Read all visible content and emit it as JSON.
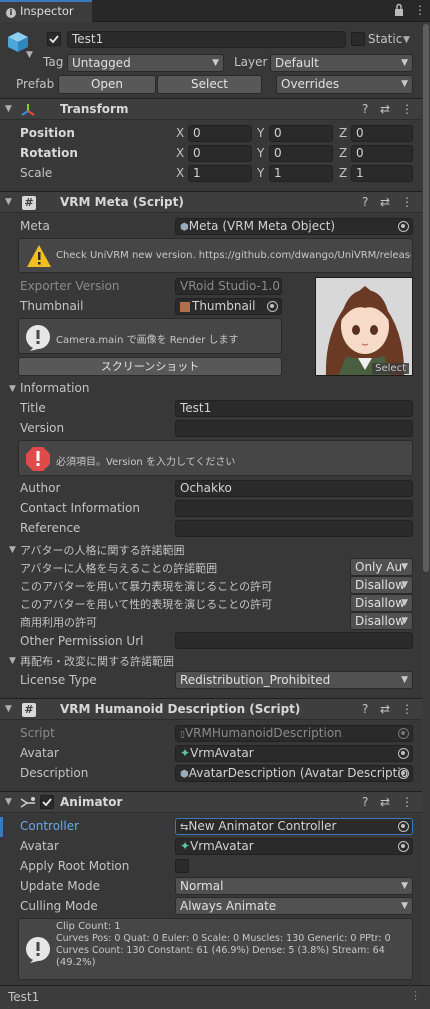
{
  "tab": {
    "title": "Inspector"
  },
  "gameobject": {
    "name": "Test1",
    "static_label": "Static",
    "tag_label": "Tag",
    "tag_value": "Untagged",
    "layer_label": "Layer",
    "layer_value": "Default",
    "prefab_label": "Prefab",
    "open_label": "Open",
    "select_label": "Select",
    "overrides_label": "Overrides"
  },
  "transform": {
    "title": "Transform",
    "position_label": "Position",
    "rotation_label": "Rotation",
    "scale_label": "Scale",
    "x": "X",
    "y": "Y",
    "z": "Z",
    "position": [
      "0",
      "0",
      "0"
    ],
    "rotation": [
      "0",
      "0",
      "0"
    ],
    "scale": [
      "1",
      "1",
      "1"
    ]
  },
  "vrm_meta": {
    "title": "VRM Meta (Script)",
    "meta_label": "Meta",
    "meta_value": "Meta (VRM Meta Object)",
    "warning": "Check UniVRM new version. https://github.com/dwango/UniVRM/releases",
    "exporter_label": "Exporter Version",
    "exporter_value": "VRoid Studio-1.0.0",
    "thumbnail_label": "Thumbnail",
    "thumbnail_value": "Thumbnail",
    "preview_select": "Select",
    "camera_info": "Camera.main で画像を Render します",
    "screenshot_button": "スクリーンショット",
    "information_label": "Information",
    "title_label": "Title",
    "title_value": "Test1",
    "version_label": "Version",
    "version_value": "",
    "version_error": "必須項目。Version を入力してください",
    "author_label": "Author",
    "author_value": "Ochakko",
    "contact_label": "Contact Information",
    "contact_value": "",
    "reference_label": "Reference",
    "reference_value": "",
    "avatar_perm_section": "アバターの人格に関する許諾範囲",
    "perm1_label": "アバターに人格を与えることの許諾範囲",
    "perm1_value": "Only Au",
    "perm2_label": "このアバターを用いて暴力表現を演じることの許可",
    "perm2_value": "Disallow",
    "perm3_label": "このアバターを用いて性的表現を演じることの許可",
    "perm3_value": "Disallow",
    "perm4_label": "商用利用の許可",
    "perm4_value": "Disallow",
    "other_perm_label": "Other Permission Url",
    "other_perm_value": "",
    "redistribution_section": "再配布・改変に関する許諾範囲",
    "license_label": "License Type",
    "license_value": "Redistribution_Prohibited"
  },
  "humanoid": {
    "title": "VRM Humanoid Description (Script)",
    "script_label": "Script",
    "script_value": "VRMHumanoidDescription",
    "avatar_label": "Avatar",
    "avatar_value": "VrmAvatar",
    "description_label": "Description",
    "description_value": "AvatarDescription (Avatar Descriptio"
  },
  "animator": {
    "title": "Animator",
    "controller_label": "Controller",
    "controller_value": "New Animator Controller",
    "avatar_label": "Avatar",
    "avatar_value": "VrmAvatar",
    "root_motion_label": "Apply Root Motion",
    "update_mode_label": "Update Mode",
    "update_mode_value": "Normal",
    "culling_label": "Culling Mode",
    "culling_value": "Always Animate",
    "info_line1": "Clip Count: 1",
    "info_line2": "Curves Pos: 0 Quat: 0 Euler: 0 Scale: 0 Muscles: 130 Generic: 0 PPtr: 0",
    "info_line3": "Curves Count: 130 Constant: 61 (46.9%) Dense: 5 (3.8%) Stream: 64",
    "info_line4": "(49.2%)"
  },
  "footer": {
    "label": "Test1"
  },
  "colors": {
    "accent": "#3a79bb",
    "warning": "#f0c020",
    "error": "#e04a4a",
    "background": "#383838"
  }
}
